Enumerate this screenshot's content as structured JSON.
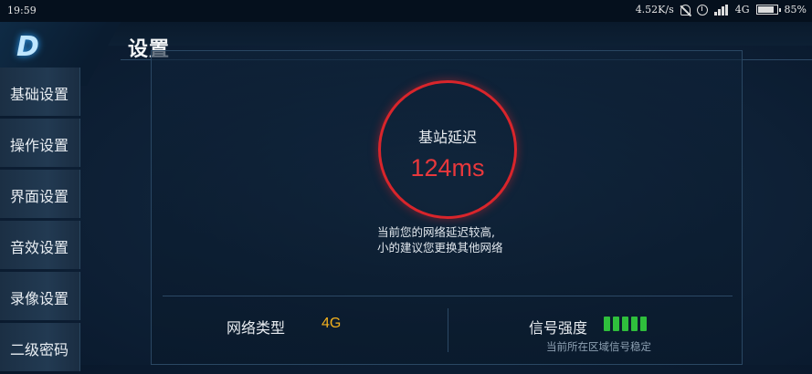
{
  "status_bar": {
    "time": "19:59",
    "speed": "4.52K/s",
    "network": "4G",
    "battery": "85%",
    "icons": [
      "mute-icon",
      "alarm-icon",
      "signal-icon",
      "battery-icon"
    ]
  },
  "header": {
    "logo_text": "D",
    "title": "设置"
  },
  "sidebar": {
    "items": [
      {
        "label": "基础设置"
      },
      {
        "label": "操作设置"
      },
      {
        "label": "界面设置"
      },
      {
        "label": "音效设置"
      },
      {
        "label": "录像设置"
      },
      {
        "label": "二级密码"
      }
    ]
  },
  "latency": {
    "label": "基站延迟",
    "value": "124ms",
    "tip_line1": "当前您的网络延迟较高,",
    "tip_line2": "小的建议您更换其他网络"
  },
  "network_info": {
    "type_label": "网络类型",
    "type_value": "4G",
    "signal_label": "信号强度",
    "signal_bars": 5,
    "signal_note": "当前所在区域信号稳定"
  },
  "colors": {
    "accent_red": "#d9252b",
    "value_yellow": "#f2b01e",
    "signal_green": "#2fbf3c"
  }
}
